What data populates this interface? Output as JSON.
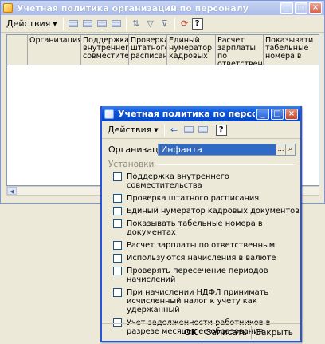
{
  "bg_window": {
    "title": "Учетная политика организаций по персоналу",
    "toolbar_menu": "Действия",
    "columns": [
      "Организация",
      "Поддержка внутреннего совместите…",
      "Проверка штатного расписан…",
      "Единый нумератор кадровых",
      "Расчет зарплаты по ответственн…",
      "Показывати табельные номера в"
    ]
  },
  "dialog": {
    "title": "Учетная политика по персоналу о…: *",
    "toolbar_menu": "Действия",
    "org_label": "Организация:",
    "org_value": "Инфанта",
    "section": "Установки",
    "checkboxes": [
      "Поддержка внутреннего совместительства",
      "Проверка штатного расписания",
      "Единый нумератор кадровых документов",
      "Показывать табельные номера в документах",
      "Расчет зарплаты по ответственным",
      "Используются начисления в валюте",
      "Проверять пересечение периодов начислений",
      "При начислении НДФЛ принимать исчисленный налог к учету как удержанный",
      "Учет задолженности работников в разрезе месяцев ее образования"
    ],
    "buttons": {
      "ok": "OK",
      "save": "Записать",
      "close": "Закрыть"
    }
  }
}
